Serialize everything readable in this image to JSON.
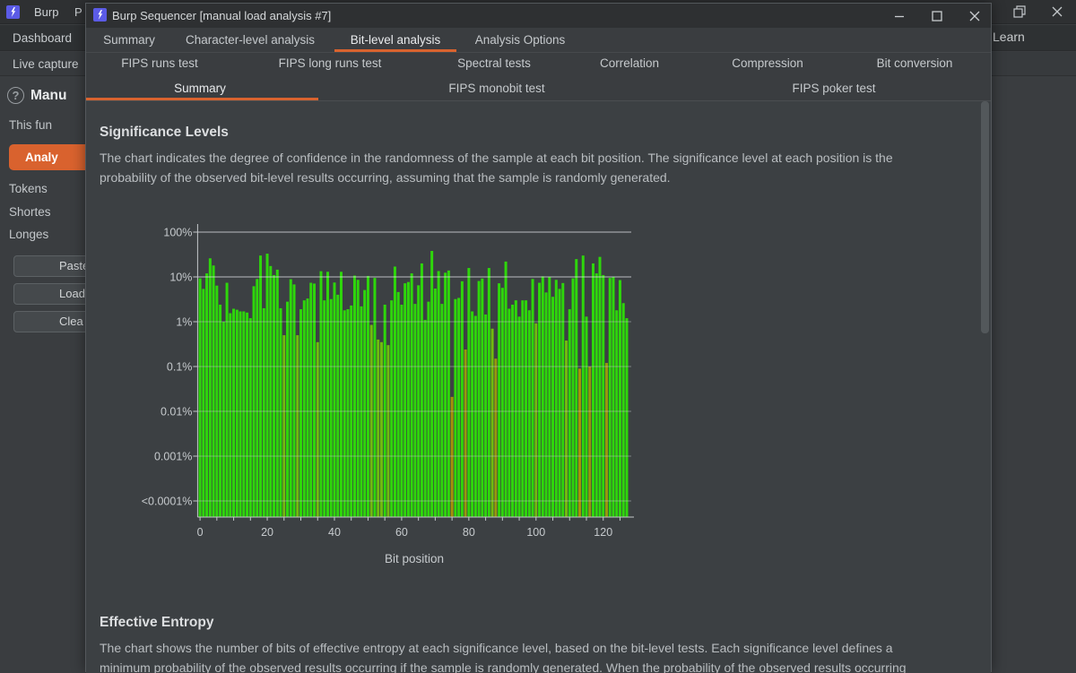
{
  "main_window": {
    "menu_items": [
      "Burp",
      "P"
    ],
    "tabs": [
      "Dashboard"
    ],
    "subtabs": [
      "Live capture"
    ],
    "learn_label": "Learn",
    "sidebar": {
      "heading": "Manu",
      "description": "This fun",
      "analyze_button": "Analy",
      "info_labels": [
        "Tokens",
        "Shortes",
        "Longes"
      ],
      "buttons": [
        "Paste",
        "Load",
        "Clea"
      ],
      "help_icon": "?"
    }
  },
  "popup": {
    "title": "Burp Sequencer [manual load analysis #7]",
    "window_buttons": [
      "minimize",
      "maximize",
      "close"
    ],
    "tabs": [
      {
        "label": "Summary",
        "selected": false
      },
      {
        "label": "Character-level analysis",
        "selected": false
      },
      {
        "label": "Bit-level analysis",
        "selected": true
      },
      {
        "label": "Analysis Options",
        "selected": false
      }
    ],
    "subtabs_row1": [
      "FIPS runs test",
      "FIPS long runs test",
      "Spectral tests",
      "Correlation",
      "Compression",
      "Bit conversion"
    ],
    "subtabs_row2": [
      {
        "label": "Summary",
        "selected": true
      },
      {
        "label": "FIPS monobit test",
        "selected": false
      },
      {
        "label": "FIPS poker test",
        "selected": false
      }
    ],
    "significance_section": {
      "heading": "Significance Levels",
      "body_line1": "The chart indicates the degree of confidence in the randomness of the sample at each bit position. The significance level at each position is the",
      "body_line2": "probability of the observed bit-level results occurring, assuming that the sample is randomly generated."
    },
    "entropy_section": {
      "heading": "Effective Entropy",
      "body_line1": "The chart shows the number of bits of effective entropy at each significance level, based on the bit-level tests. Each significance level defines a",
      "body_line2": "minimum probability of the observed results occurring if the sample is randomly generated. When the probability of the observed results occurring"
    }
  },
  "chart_data": {
    "type": "bar",
    "title": "Significance Levels",
    "xlabel": "Bit position",
    "ylabel": "",
    "y_scale": "log",
    "y_axis_labels": [
      "100%",
      "10%",
      "1%",
      "0.1%",
      "0.01%",
      "0.001%",
      "<0.0001%"
    ],
    "y_axis_values": [
      100,
      10,
      1,
      0.1,
      0.01,
      0.001,
      0.0001
    ],
    "x_tick_labels": [
      0,
      20,
      40,
      60,
      80,
      100,
      120
    ],
    "categories_note": "bit positions 0-127",
    "values": [
      9.3,
      5.4,
      12,
      26,
      18,
      6.4,
      2.4,
      1.0,
      7.4,
      1.55,
      1.95,
      1.85,
      1.7,
      1.7,
      1.6,
      1.2,
      6.2,
      9.0,
      30,
      2.0,
      33,
      17.5,
      11,
      14.5,
      2.0,
      0.5,
      2.8,
      8.9,
      6.8,
      0.5,
      1.9,
      3.0,
      3.3,
      7.4,
      7.1,
      0.35,
      13.4,
      3.0,
      13,
      3.2,
      7.5,
      4.0,
      13,
      1.8,
      1.9,
      2.3,
      10.7,
      8.6,
      2.2,
      5.1,
      10.5,
      0.85,
      9.5,
      0.4,
      0.35,
      2.4,
      0.3,
      3.0,
      17,
      4.6,
      2.4,
      7.2,
      7.7,
      12,
      2.5,
      6.5,
      20,
      1.1,
      2.8,
      38,
      5.5,
      13.5,
      2.5,
      12.4,
      13.9,
      0.021,
      3.2,
      3.4,
      8.0,
      0.24,
      15.8,
      1.7,
      1.35,
      8.1,
      9.2,
      1.45,
      15.8,
      0.7,
      0.15,
      7.2,
      5.7,
      22,
      1.95,
      2.4,
      3.0,
      1.3,
      3.0,
      3.0,
      1.8,
      9.0,
      0.92,
      7.4,
      10.3,
      4.5,
      10,
      3.6,
      8.6,
      5.4,
      7.3,
      0.38,
      1.9,
      9.3,
      25,
      0.09,
      30,
      1.3,
      0.1,
      20,
      12,
      28,
      11,
      0.12,
      9.5,
      10,
      1.8,
      8.5,
      2.6,
      1.2
    ],
    "bar_colors": {
      "green_1pct_and_above": "#2ed60b",
      "yellow_green_0.3_to_1pct": "#71bb0f",
      "olive_0.1_to_0.3pct": "#97990d",
      "dark_yellow_below_0.1pct": "#a6920a"
    },
    "grid": true,
    "legend": false
  }
}
